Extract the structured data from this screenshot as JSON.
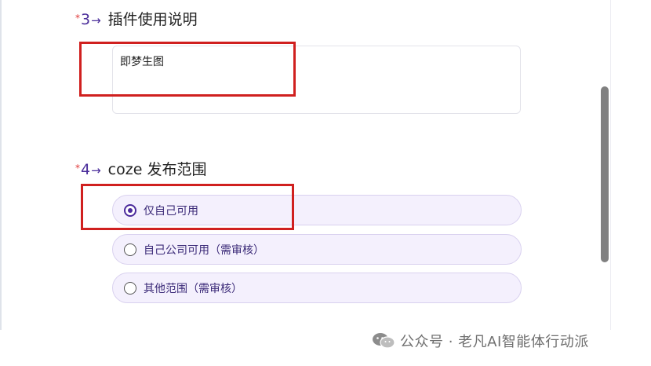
{
  "question3": {
    "star": "*",
    "number": "3",
    "arrow": "→",
    "title": "插件使用说明",
    "textarea_value": "即梦生图"
  },
  "question4": {
    "star": "*",
    "number": "4",
    "arrow": "→",
    "title": "coze 发布范围",
    "options": [
      {
        "label": "仅自己可用",
        "selected": true
      },
      {
        "label": "自己公司可用（需审核）",
        "selected": false
      },
      {
        "label": "其他范围（需审核）",
        "selected": false
      }
    ]
  },
  "watermark": {
    "text": "公众号 · 老凡AI智能体行动派",
    "icon": "wechat-icon"
  },
  "colors": {
    "accent": "#4a2d9a",
    "required_star": "#e03a3a",
    "highlight_box": "#d0201f",
    "option_bg": "#f4f0fd"
  }
}
